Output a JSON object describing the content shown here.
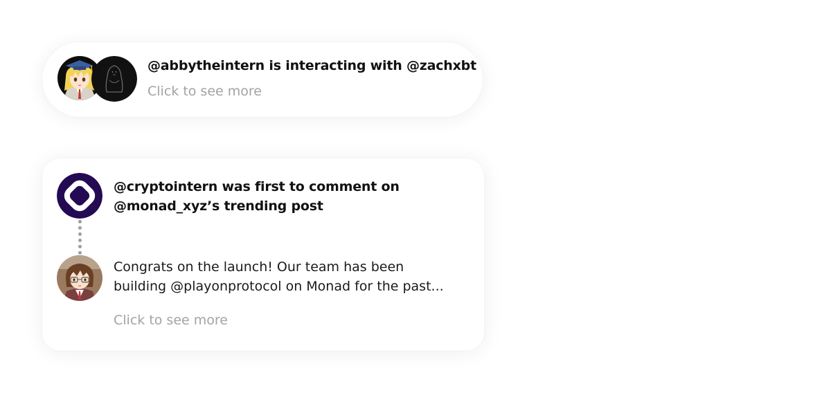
{
  "cards": {
    "interaction": {
      "title": "@abbytheintern is interacting with @zachxbt",
      "cta": "Click to see more",
      "avatars": [
        "abbytheintern-avatar",
        "zachxbt-avatar"
      ]
    },
    "comment": {
      "title_line1": "@cryptointern was first to comment on",
      "title_line2": "@monad_xyz’s trending post",
      "body_line1": "Congrats on the launch! Our team has been",
      "body_line2": "building @playonprotocol on Monad for the past...",
      "cta": "Click to see more",
      "avatars": [
        "monad-avatar",
        "cryptointern-avatar"
      ]
    }
  },
  "colors": {
    "monad_purple": "#240a53",
    "muted_text": "#a3a3a3",
    "title_text": "#111111",
    "thread_line": "#9e9e9e"
  }
}
